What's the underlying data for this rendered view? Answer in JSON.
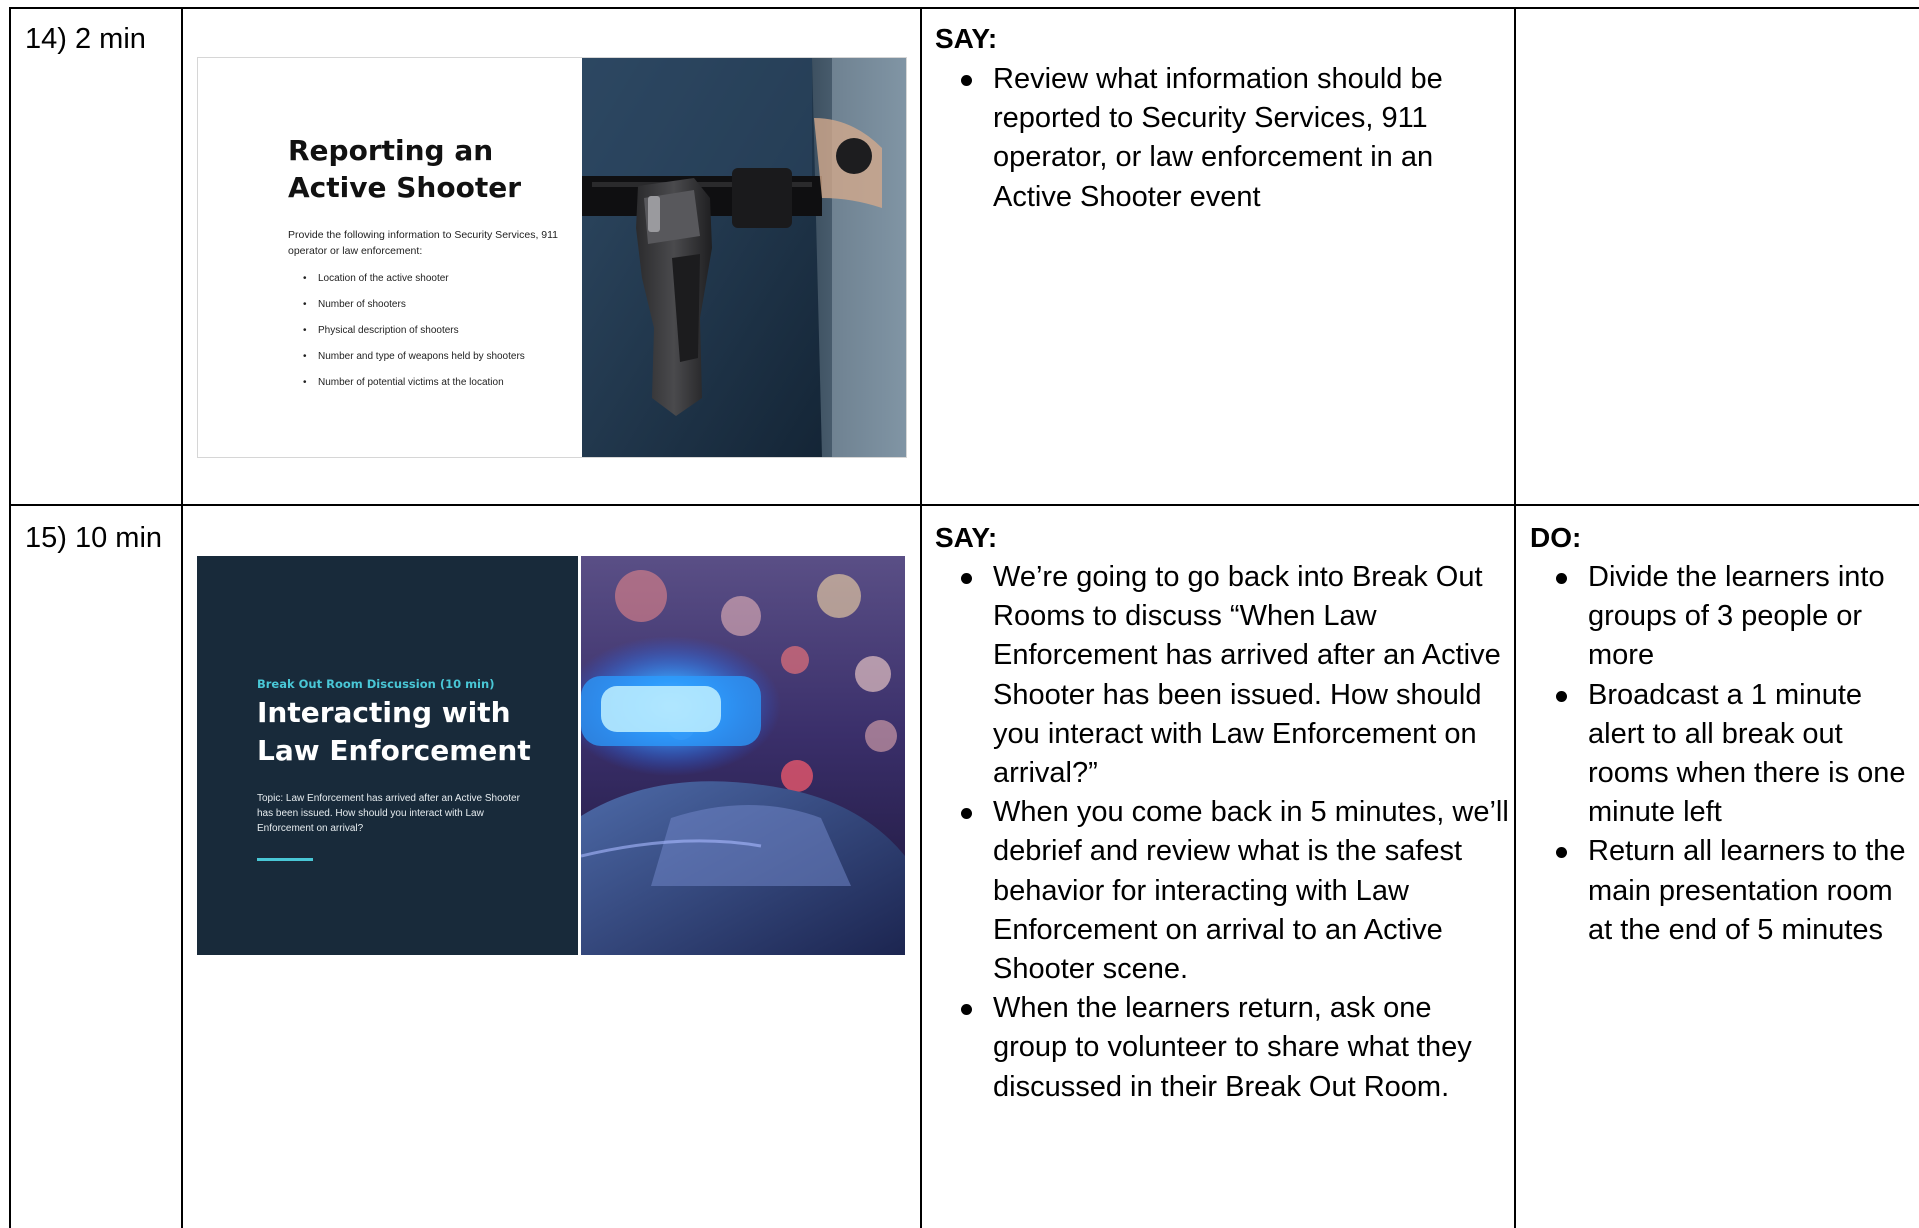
{
  "rows": [
    {
      "time": "14) 2 min",
      "say_label": "SAY:",
      "say_items": [
        "Review what information should be reported to Security Services, 911 operator, or law enforcement in an Active Shooter event"
      ],
      "slide": {
        "title": "Reporting an Active Shooter",
        "intro": "Provide the following information to Security Services, 911 operator or law enforcement:",
        "items": [
          "Location of the active shooter",
          "Number of shooters",
          "Physical description of shooters",
          "Number and type of weapons held by shooters",
          "Number of potential victims at the location"
        ]
      }
    },
    {
      "time": "15) 10 min",
      "say_label": "SAY:",
      "say_items": [
        "We’re going to go back into Break Out Rooms to discuss “When Law Enforcement has arrived after an Active Shooter has been issued.  How should you interact with Law Enforcement on arrival?”",
        "When you come back in 5 minutes, we’ll debrief and review what is the safest behavior for interacting with Law Enforcement on arrival to an Active Shooter scene.",
        "When the learners return, ask one group to volunteer to share what they discussed in their Break Out Room."
      ],
      "do_label": "DO:",
      "do_items": [
        "Divide the learners into groups of 3 people or more",
        "Broadcast a 1 minute alert to all break out rooms when there is one minute left",
        "Return all learners to the main presentation room at the end of 5 minutes"
      ],
      "slide": {
        "kicker": "Break Out Room Discussion (10 min)",
        "title": "Interacting with Law Enforcement",
        "topic": "Topic:  Law Enforcement has arrived after an Active Shooter has been issued.  How should you interact with Law Enforcement on arrival?"
      }
    }
  ],
  "colors": {
    "slide2_background": "#182a3a",
    "slide2_accent": "#49c7d6",
    "grid": "#000000"
  }
}
